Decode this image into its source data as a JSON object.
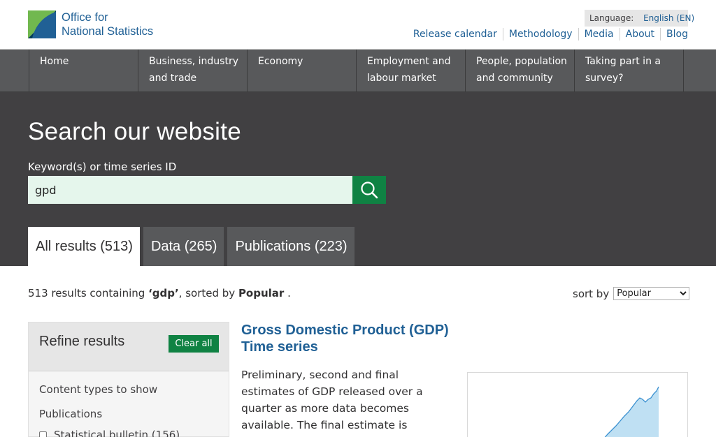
{
  "header": {
    "logo_line1": "Office for",
    "logo_line2": "National Statistics",
    "language_label": "Language:",
    "language_value": "English (EN)",
    "links": [
      "Release calendar",
      "Methodology",
      "Media",
      "About",
      "Blog"
    ]
  },
  "nav": {
    "items": [
      {
        "label": "Home"
      },
      {
        "label": "Business, industry and trade"
      },
      {
        "label": "Economy"
      },
      {
        "label": "Employment and labour market"
      },
      {
        "label": "People, population and community"
      },
      {
        "label": "Taking part in a survey?"
      }
    ]
  },
  "search": {
    "title": "Search our website",
    "label": "Keyword(s) or time series ID",
    "value": "gpd"
  },
  "tabs": [
    {
      "label": "All results (513)",
      "active": true
    },
    {
      "label": "Data (265)",
      "active": false
    },
    {
      "label": "Publications (223)",
      "active": false
    }
  ],
  "summary": {
    "count_text": "513 results containing ",
    "query": "‘gdp’",
    "sorted_by_text": ", sorted by ",
    "sort_value": "Popular",
    "end": " ."
  },
  "sort": {
    "label": "sort by",
    "selected": "Popular"
  },
  "refine": {
    "title": "Refine results",
    "clear_label": "Clear all",
    "content_types_label": "Content types to show",
    "publications_label": "Publications",
    "checkbox_label": "Statistical bulletin (156)"
  },
  "result": {
    "title": "Gross Domestic Product (GDP) Time series",
    "description": "Preliminary, second and final estimates of GDP  released over a quarter as more data becomes available. The final estimate is published in the Quarterly"
  },
  "colors": {
    "brand_blue": "#206095",
    "brand_green": "#0f8243",
    "banner_bg": "#414042",
    "nav_bg": "#58595b",
    "sparkline_fill": "#bfe0f3",
    "sparkline_line": "#3a90d0"
  }
}
